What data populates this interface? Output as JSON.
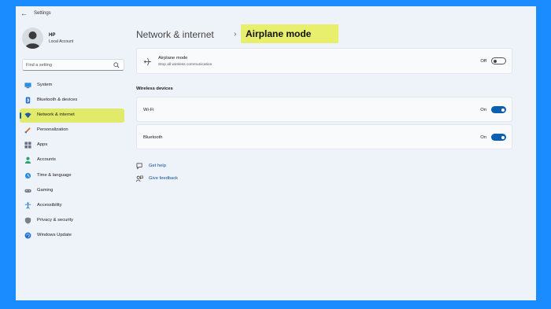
{
  "window": {
    "title": "Settings"
  },
  "profile": {
    "name": "HP",
    "account_type": "Local Account"
  },
  "search": {
    "placeholder": "Find a setting"
  },
  "sidebar": {
    "items": [
      {
        "label": "System",
        "icon": "monitor-icon",
        "active": false
      },
      {
        "label": "Bluetooth & devices",
        "icon": "bluetooth-icon",
        "active": false
      },
      {
        "label": "Network & internet",
        "icon": "wifi-icon",
        "active": true
      },
      {
        "label": "Personalization",
        "icon": "brush-icon",
        "active": false
      },
      {
        "label": "Apps",
        "icon": "apps-icon",
        "active": false
      },
      {
        "label": "Accounts",
        "icon": "person-icon",
        "active": false
      },
      {
        "label": "Time & language",
        "icon": "globe-clock-icon",
        "active": false
      },
      {
        "label": "Gaming",
        "icon": "gamepad-icon",
        "active": false
      },
      {
        "label": "Accessibility",
        "icon": "accessibility-icon",
        "active": false
      },
      {
        "label": "Privacy & security",
        "icon": "shield-icon",
        "active": false
      },
      {
        "label": "Windows Update",
        "icon": "update-icon",
        "active": false
      }
    ]
  },
  "breadcrumb": {
    "parent": "Network & internet",
    "separator": "›",
    "current": "Airplane mode"
  },
  "airplane": {
    "title": "Airplane mode",
    "subtitle": "Stop all wireless communication",
    "state": "Off"
  },
  "wireless": {
    "heading": "Wireless devices",
    "wifi": {
      "label": "Wi-Fi",
      "state": "On"
    },
    "bluetooth": {
      "label": "Bluetooth",
      "state": "On"
    }
  },
  "help": {
    "get_help": "Get help",
    "give_feedback": "Give feedback"
  },
  "colors": {
    "accent": "#0a5fb0",
    "highlight": "#e8ef6d",
    "background": "#1a8cff"
  }
}
